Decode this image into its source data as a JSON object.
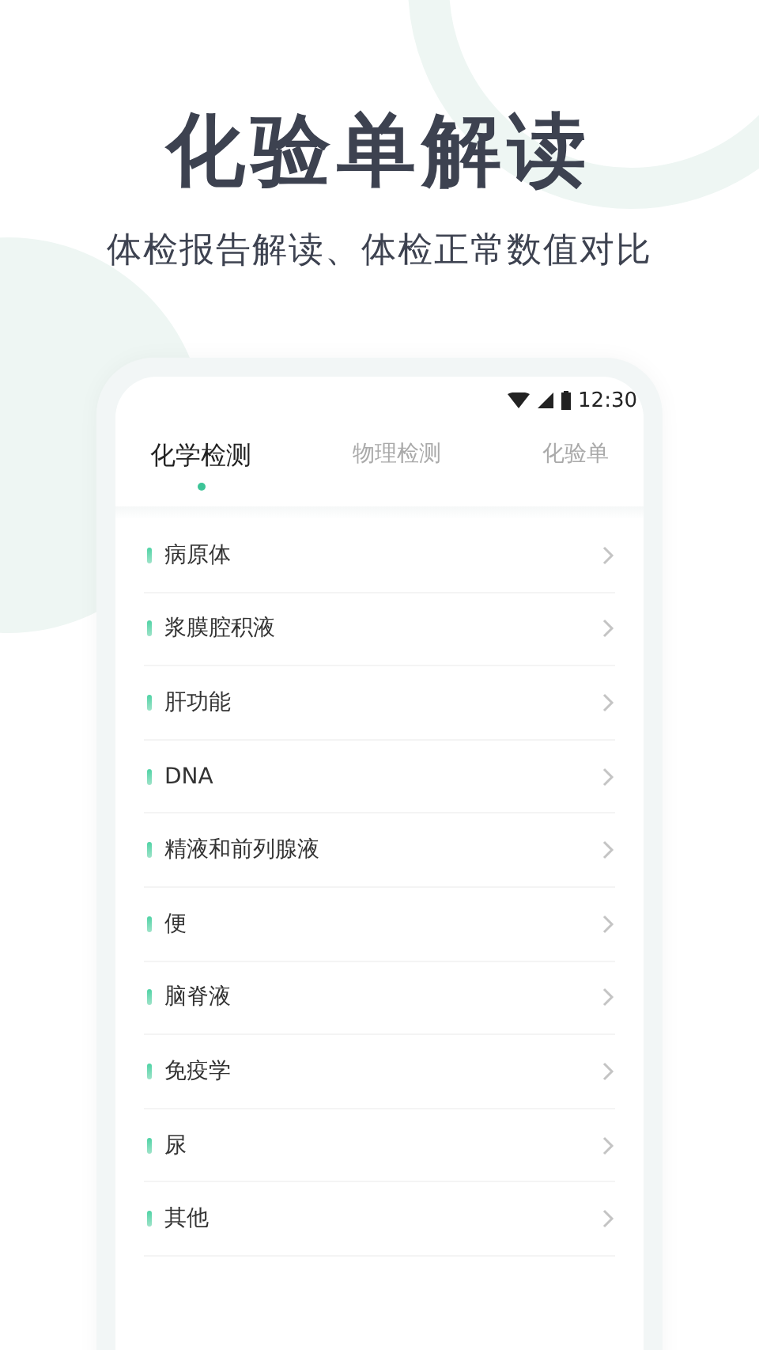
{
  "headline": "化验单解读",
  "subtitle": "体检报告解读、体检正常数值对比",
  "status_bar": {
    "time": "12:30"
  },
  "tabs": [
    {
      "label": "化学检测",
      "selected": true
    },
    {
      "label": "物理检测",
      "selected": false
    },
    {
      "label": "化验单",
      "selected": false
    }
  ],
  "items": [
    {
      "label": "病原体"
    },
    {
      "label": "浆膜腔积液"
    },
    {
      "label": "肝功能"
    },
    {
      "label": "DNA"
    },
    {
      "label": "精液和前列腺液"
    },
    {
      "label": "便"
    },
    {
      "label": "脑脊液"
    },
    {
      "label": "免疫学"
    },
    {
      "label": "尿"
    },
    {
      "label": "其他"
    }
  ]
}
